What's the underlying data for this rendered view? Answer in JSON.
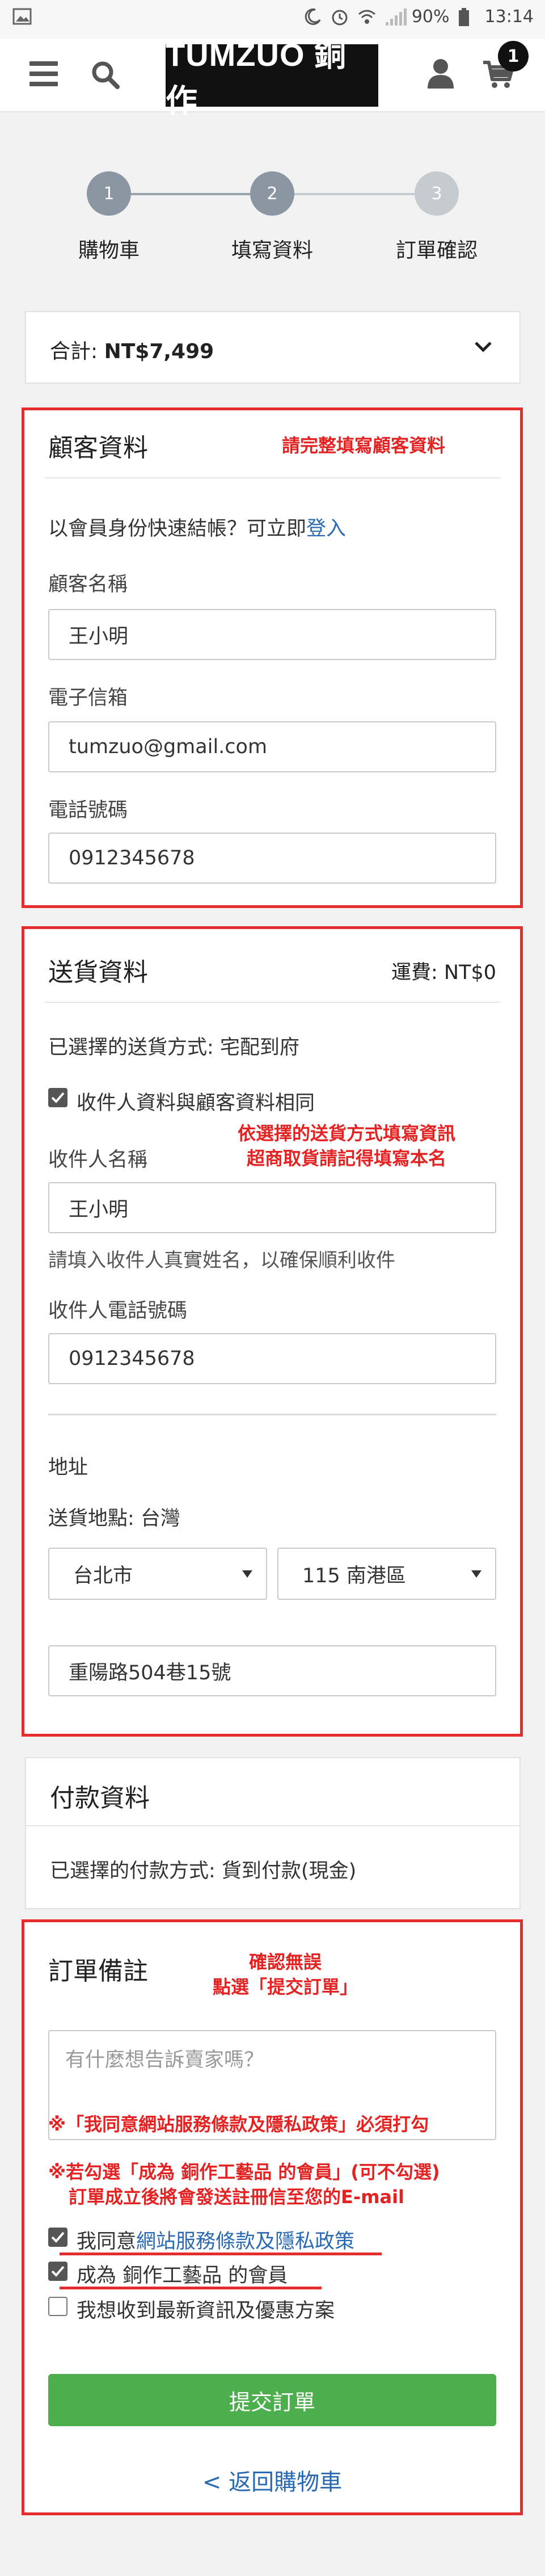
{
  "status_bar": {
    "battery": "90%",
    "time": "13:14"
  },
  "header": {
    "logo_text": "TUMZUO 銅作",
    "cart_count": "1"
  },
  "steps": [
    {
      "number": "1",
      "label": "購物車"
    },
    {
      "number": "2",
      "label": "填寫資料"
    },
    {
      "number": "3",
      "label": "訂單確認"
    }
  ],
  "total": {
    "label": "合計:",
    "amount": "NT$7,499"
  },
  "customer": {
    "title": "顧客資料",
    "annotation": "請完整填寫顧客資料",
    "login_prompt": "以會員身份快速結帳？可立即",
    "login_link": "登入",
    "name_label": "顧客名稱",
    "name_value": "王小明",
    "email_label": "電子信箱",
    "email_value": "tumzuo@gmail.com",
    "phone_label": "電話號碼",
    "phone_value": "0912345678"
  },
  "shipping": {
    "title": "送貨資料",
    "fee": "運費: NT$0",
    "method": "已選擇的送貨方式: 宅配到府",
    "same_as_customer": "收件人資料與顧客資料相同",
    "annotation_line1": "依選擇的送貨方式填寫資訊",
    "annotation_line2": "超商取貨請記得填寫本名",
    "recipient_label": "收件人名稱",
    "recipient_value": "王小明",
    "recipient_hint": "請填入收件人真實姓名，以確保順利收件",
    "recipient_phone_label": "收件人電話號碼",
    "recipient_phone_value": "0912345678",
    "address_label": "地址",
    "delivery_location": "送貨地點: 台灣",
    "city": "台北市",
    "district": "115 南港區",
    "address_value": "重陽路504巷15號"
  },
  "payment": {
    "title": "付款資料",
    "method": "已選擇的付款方式: 貨到付款(現金)"
  },
  "order_notes": {
    "title": "訂單備註",
    "annotation_line1": "確認無誤",
    "annotation_line2": "點選「提交訂單」",
    "placeholder": "有什麼想告訴賣家嗎？",
    "note1": "※「我同意網站服務條款及隱私政策」必須打勾",
    "note2_line1": "※若勾選「成為 銅作工藝品 的會員」(可不勾選)",
    "note2_line2": "訂單成立後將會發送註冊信至您的E-mail",
    "agree_prefix": "我同意",
    "agree_link": "網站服務條款及隱私政策",
    "member_label": "成為 銅作工藝品 的會員",
    "newsletter_label": "我想收到最新資訊及優惠方案",
    "submit_label": "提交訂單",
    "back_label": "< 返回購物車"
  },
  "colors": {
    "accent_red": "#e52d2d",
    "submit_green": "#4cae4c",
    "link_blue": "#2a6ab3",
    "step_done": "#8a96a1",
    "step_pending": "#c5cbd0"
  }
}
